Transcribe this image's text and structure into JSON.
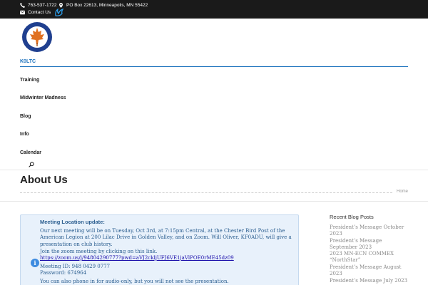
{
  "topbar": {
    "phone": "763-537-1722",
    "address": "PO Box 22613, Minneapolis, MN 55422",
    "contact": "Contact Us"
  },
  "nav": {
    "brand": "K0LTC",
    "items": [
      "Training",
      "Midwinter Madness",
      "Blog",
      "Info",
      "Calendar"
    ]
  },
  "page": {
    "title": "About Us",
    "breadcrumb": "Home"
  },
  "notice": {
    "title": "Meeting Location update:",
    "line1": "Our next meeting will be on Tuesday, Oct 3rd, at 7:15pm Central, at the Chester Bird Post of the",
    "line2": "American Legion at 200 Lilac Drive in Golden Valley, and on Zoom. Will Oliver, KF0ADU, will give a",
    "line3": "presentation on club history.",
    "zoom_text": "Join the zoom meeting by clicking on this link.",
    "zoom_link": "https://zoom.us/j/94804290777?pwd=aVJ2ckljUFJ6VE1jaVlPOE0rME45dz09",
    "meeting_id": "Meeting ID: 948 0429 0777",
    "passcode": "Password: 674964",
    "phone_note": "You can also phone in for audio-only, but you will not see the presentation."
  },
  "sidebar": {
    "heading": "Recent Blog Posts",
    "posts": [
      "President’s Message October",
      "2023",
      "President’s Message",
      "September 2023",
      "2023 MN-ECN COMMEX",
      "“NorthStar”",
      "President’s Message August",
      "2023",
      "President’s Message July 2023"
    ]
  },
  "colors": {
    "topbar_bg": "#1a1a1a",
    "accent": "#1e73be",
    "notice_bg": "#e8f1fb",
    "notice_text": "#2a5d8f"
  }
}
